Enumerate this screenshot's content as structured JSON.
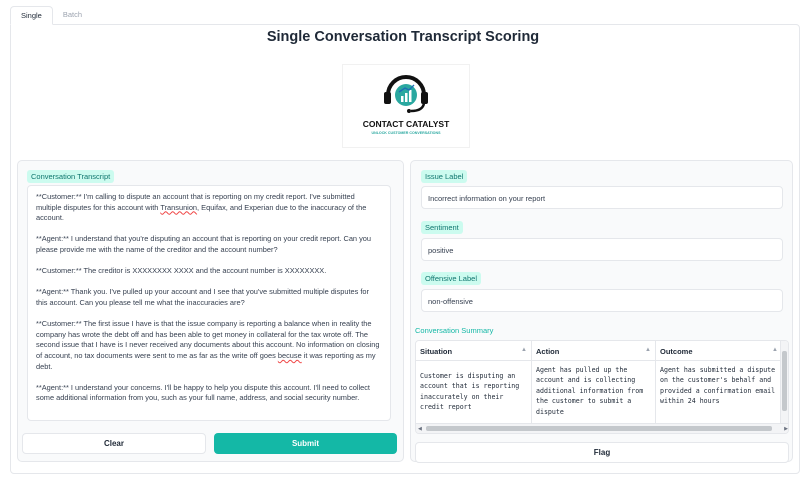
{
  "tabs": [
    "Single",
    "Batch"
  ],
  "title": "Single Conversation Transcript Scoring",
  "logo": {
    "name": "CONTACT CATALYST",
    "tagline": "UNLOCK CUSTOMER CONVERSATIONS",
    "colors": {
      "dark": "#111111",
      "teal": "#2aa8a0",
      "blue": "#1e6fb5"
    }
  },
  "transcript": {
    "label": "Conversation Transcript",
    "paragraphs": [
      {
        "pre": "**Customer:** I'm calling to dispute an account that is reporting on my credit report. I've submitted multiple disputes for this account with ",
        "sq": "Transunion",
        "post": ", Equifax, and Experian due to the inaccuracy of the account."
      },
      {
        "pre": "**Agent:** I understand that you're disputing an account that is reporting on your credit report. Can you please provide me with the name of the creditor and the account number?",
        "sq": "",
        "post": ""
      },
      {
        "pre": "**Customer:** The creditor is XXXXXXXX XXXX and the account number is XXXXXXXX.",
        "sq": "",
        "post": ""
      },
      {
        "pre": "**Agent:** Thank you. I've pulled up your account and I see that you've submitted multiple disputes for this account. Can you please tell me what the inaccuracies are?",
        "sq": "",
        "post": ""
      },
      {
        "pre": "**Customer:** The first issue I have is that the issue company is reporting a balance when in reality the company has wrote the debt off and has been able to get money in collateral for the tax wrote off. The second issue that I have is I never received any documents about this account. No information on closing of account, no tax documents were sent to me as far as the write off goes ",
        "sq": "becuse",
        "post": " it was reporting as my debt."
      },
      {
        "pre": "**Agent:** I understand your concerns. I'll be happy to help you dispute this account. I'll need to collect some additional information from you, such as your full name, address, and social security number.",
        "sq": "",
        "post": ""
      }
    ]
  },
  "buttons": {
    "clear": "Clear",
    "submit": "Submit",
    "flag": "Flag"
  },
  "issue": {
    "label": "Issue Label",
    "value": "Incorrect information on your report"
  },
  "sentiment": {
    "label": "Sentiment",
    "value": "positive"
  },
  "offensive": {
    "label": "Offensive Label",
    "value": "non-offensive"
  },
  "summary": {
    "label": "Conversation Summary",
    "columns": [
      "Situation",
      "Action",
      "Outcome"
    ],
    "row": [
      "Customer is disputing an account that is reporting inaccurately on their credit report",
      "Agent has pulled up the account and is collecting additional information from the customer to submit a dispute",
      "Agent has submitted a dispute on the customer's behalf and provided a confirmation email within 24 hours"
    ]
  },
  "colors": {
    "accent": "#14b8a6",
    "badge_bg": "#ccfbef",
    "badge_text": "#0f766e"
  }
}
